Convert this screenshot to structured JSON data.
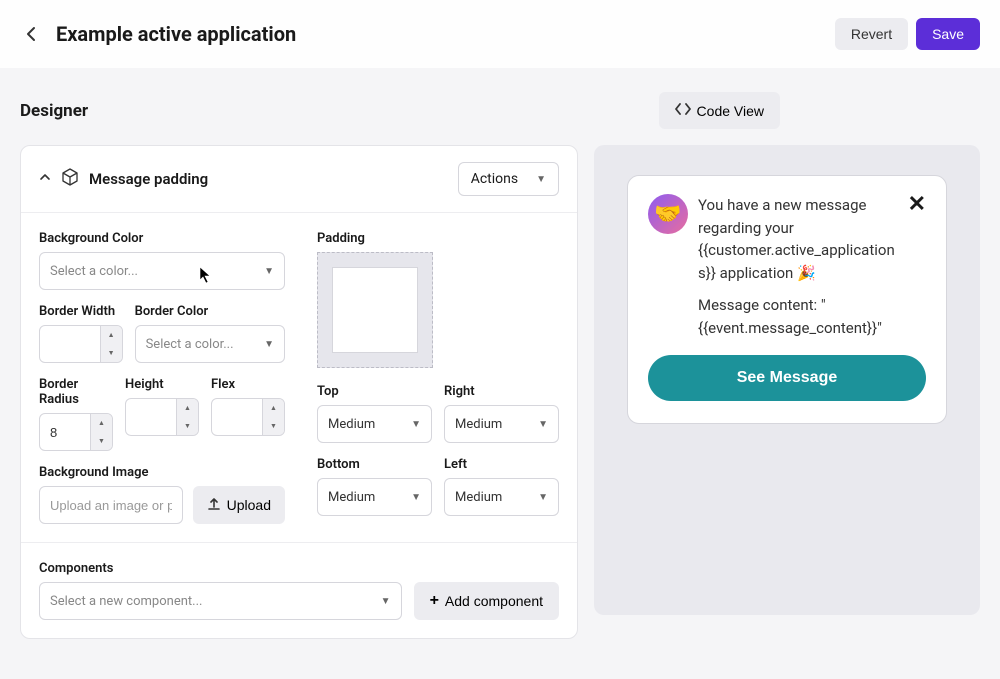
{
  "header": {
    "title": "Example active application",
    "revert": "Revert",
    "save": "Save"
  },
  "section": {
    "title": "Designer",
    "code_view": "Code View"
  },
  "panel": {
    "name": "Message padding",
    "actions": "Actions"
  },
  "fields": {
    "bg_color_label": "Background Color",
    "bg_color_placeholder": "Select a color...",
    "border_width_label": "Border Width",
    "border_color_label": "Border Color",
    "border_color_placeholder": "Select a color...",
    "border_radius_label": "Border Radius",
    "border_radius_value": "8",
    "height_label": "Height",
    "flex_label": "Flex",
    "bg_image_label": "Background Image",
    "bg_image_placeholder": "Upload an image or pas",
    "upload_btn": "Upload",
    "padding_label": "Padding",
    "top_label": "Top",
    "right_label": "Right",
    "bottom_label": "Bottom",
    "left_label": "Left",
    "pad_value": "Medium"
  },
  "components": {
    "label": "Components",
    "placeholder": "Select a new component...",
    "add_btn": "Add component"
  },
  "preview": {
    "line1": "You have a new message regarding your {{customer.active_applications}} application 🎉",
    "line2": "Message content: \"{{event.message_content}}\"",
    "cta": "See Message"
  }
}
